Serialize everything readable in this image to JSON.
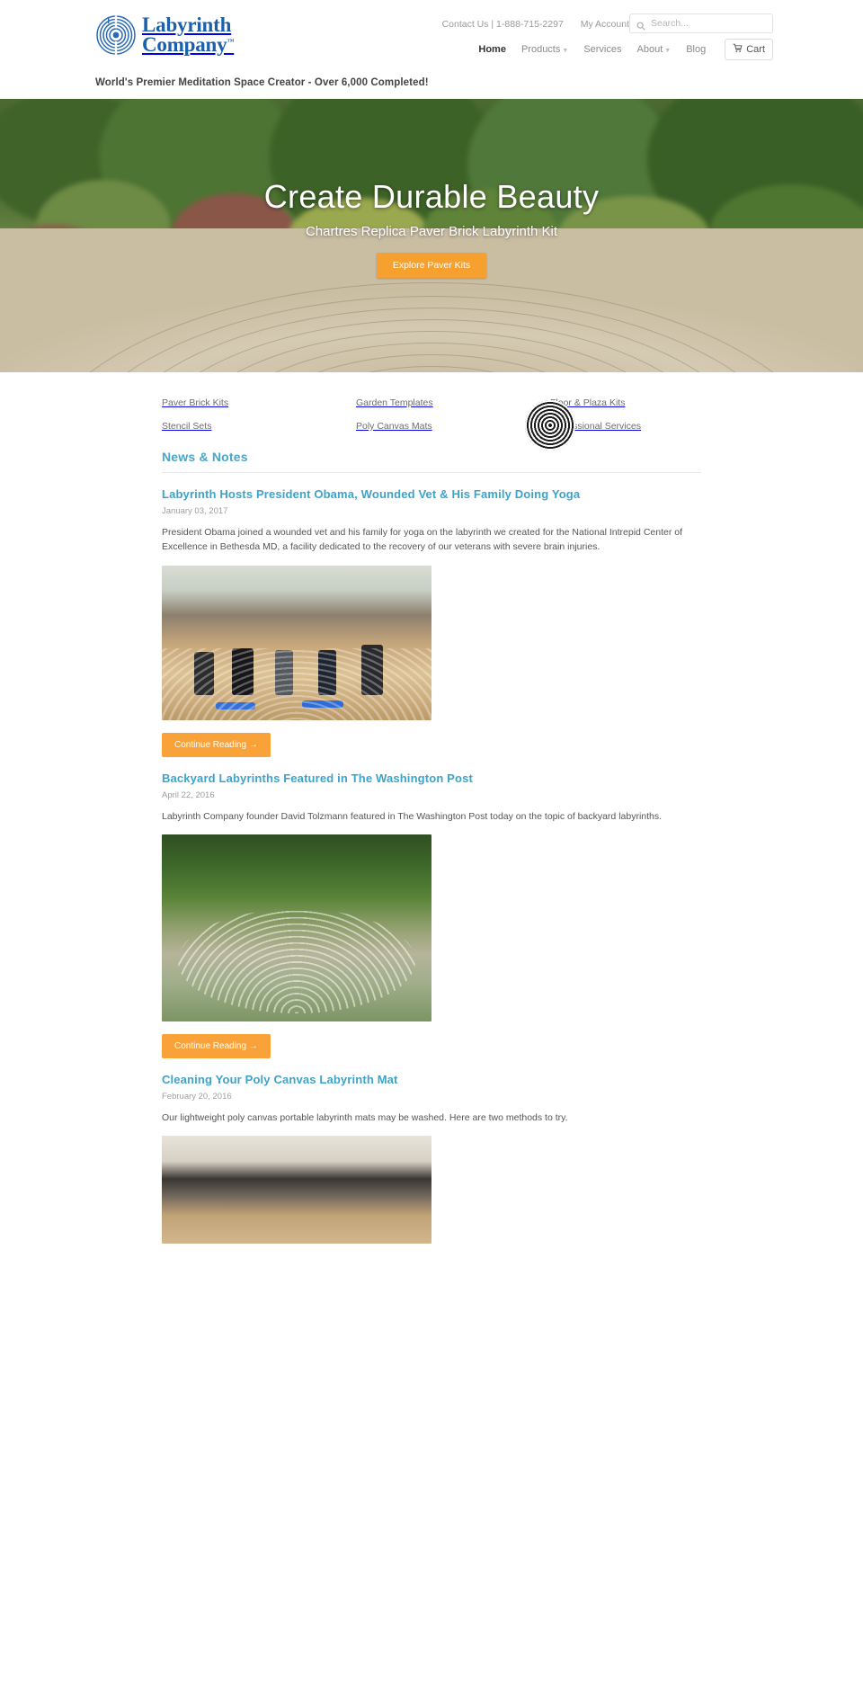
{
  "header": {
    "logo": {
      "line1": "Labyrinth",
      "line2": "Company",
      "tm": "™",
      "icon": "labyrinth-logo-icon"
    },
    "utility": {
      "contact_label": "Contact Us | 1-888-715-2297",
      "my_account_label": "My Account"
    },
    "search": {
      "placeholder": "Search...",
      "value": "",
      "icon": "search-icon"
    },
    "nav": [
      {
        "label": "Home",
        "active": true,
        "dropdown": false
      },
      {
        "label": "Products",
        "active": false,
        "dropdown": true
      },
      {
        "label": "Services",
        "active": false,
        "dropdown": false
      },
      {
        "label": "About",
        "active": false,
        "dropdown": true
      },
      {
        "label": "Blog",
        "active": false,
        "dropdown": false
      }
    ],
    "cart": {
      "label": "Cart",
      "icon": "shopping-cart-icon"
    },
    "tagline": "World's Premier Meditation Space Creator - Over 6,000 Completed!"
  },
  "hero": {
    "heading": "Create Durable Beauty",
    "subheading": "Chartres Replica Paver Brick Labyrinth Kit",
    "cta_label": "Explore Paver Kits",
    "cta_color": "#f5a02f"
  },
  "categories": [
    {
      "label": "Paver Brick Kits",
      "art": "t-bldg"
    },
    {
      "label": "Garden Templates",
      "art": "t-garden"
    },
    {
      "label": "Floor & Plaza Kits",
      "art": "t-floor"
    },
    {
      "label": "Stencil Sets",
      "art": "t-stencil"
    },
    {
      "label": "Poly Canvas Mats",
      "art": "t-poly"
    },
    {
      "label": "Professional Services",
      "art": "t-pro"
    }
  ],
  "news": {
    "heading": "News & Notes",
    "heading_color": "#4aa6c8",
    "read_more_label": "Continue Reading →",
    "articles": [
      {
        "title": "Labyrinth Hosts President Obama, Wounded Vet & His Family Doing Yoga",
        "date": "January 03, 2017",
        "body": "President Obama joined a wounded vet and his family for yoga on the labyrinth we created for the National Intrepid Center of Excellence in Bethesda MD, a facility dedicated to the recovery of our veterans with severe brain injuries."
      },
      {
        "title": "Backyard Labyrinths Featured in The Washington Post",
        "date": "April 22, 2016",
        "body": "Labyrinth Company founder David Tolzmann featured in The Washington Post today on the topic of backyard labyrinths."
      },
      {
        "title": "Cleaning Your Poly Canvas Labyrinth Mat",
        "date": "February 20, 2016",
        "body": "Our lightweight poly canvas portable labyrinth mats may be washed. Here are two methods to try."
      }
    ]
  }
}
